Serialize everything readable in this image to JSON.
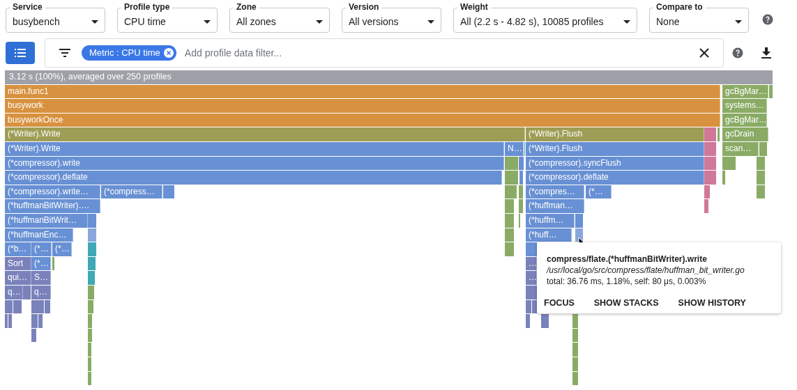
{
  "filters": [
    {
      "label": "Service",
      "value": "busybench"
    },
    {
      "label": "Profile type",
      "value": "CPU time"
    },
    {
      "label": "Zone",
      "value": "All zones"
    },
    {
      "label": "Version",
      "value": "All versions"
    },
    {
      "label": "Weight",
      "value": "All (2.2 s - 4.82 s), 10085 profiles"
    },
    {
      "label": "Compare to",
      "value": "None"
    }
  ],
  "filter_bar": {
    "chip": "Metric : CPU time",
    "placeholder": "Add profile data filter..."
  },
  "flame_graph": {
    "header": "3.12 s (100%), averaged over 250 profiles",
    "frames": [
      {
        "label": "main.func1",
        "color": "#d8923f"
      },
      {
        "label": "gcBgMar…",
        "color": "#8aab65"
      },
      {
        "label": "busywork",
        "color": "#d8923f"
      },
      {
        "label": "systems…",
        "color": "#8aab65"
      },
      {
        "label": "busyworkOnce",
        "color": "#d8923f"
      },
      {
        "label": "gcBgMar…",
        "color": "#8aab65"
      },
      {
        "label": "(*Writer).Write",
        "color": "#9e9d55"
      },
      {
        "label": "(*Writer).Flush",
        "color": "#9e9d55"
      },
      {
        "label": "gcDrain",
        "color": "#8aab65"
      },
      {
        "label": "(*Writer).Write",
        "color": "#6890d4"
      },
      {
        "label": "N…",
        "color": "#6890d4"
      },
      {
        "label": "(*Writer).Flush",
        "color": "#6890d4"
      },
      {
        "label": "scan…",
        "color": "#8aab65"
      },
      {
        "label": "(*compressor).write",
        "color": "#6890d4"
      },
      {
        "label": "(*compressor).syncFlush",
        "color": "#6890d4"
      },
      {
        "label": "(*compressor).deflate",
        "color": "#6890d4"
      },
      {
        "label": "(*compressor).deflate",
        "color": "#6890d4"
      },
      {
        "label": "(*compressor).write…",
        "color": "#6890d4"
      },
      {
        "label": "(*compress…",
        "color": "#6890d4"
      },
      {
        "label": "(*compres…",
        "color": "#6890d4"
      },
      {
        "label": "(*…",
        "color": "#6890d4"
      },
      {
        "label": "(*huffmanBitWriter)….",
        "color": "#6890d4"
      },
      {
        "label": "(*huffman…",
        "color": "#6890d4"
      },
      {
        "label": "(*huffmanBitWrit…",
        "color": "#6890d4"
      },
      {
        "label": "(*huffm…",
        "color": "#6890d4"
      },
      {
        "label": "(*huffmanEnc…",
        "color": "#6890d4"
      },
      {
        "label": "(*huff…",
        "color": "#6890d4"
      },
      {
        "label": "(*b…",
        "color": "#6890d4"
      },
      {
        "label": "(*…",
        "color": "#6890d4"
      },
      {
        "label": "(*…",
        "color": "#6890d4"
      },
      {
        "label": "Sort",
        "color": "#7a82bb"
      },
      {
        "label": "(*…",
        "color": "#6890d4"
      },
      {
        "label": "qui…",
        "color": "#7a82bb"
      },
      {
        "label": "S…",
        "color": "#7a82bb"
      },
      {
        "label": "q…",
        "color": "#7a82bb"
      },
      {
        "label": "q…",
        "color": "#7a82bb"
      },
      {
        "label": "…",
        "color": "#7a82bb"
      },
      {
        "label": "…",
        "color": "#7a82bb"
      }
    ]
  },
  "tooltip": {
    "function": "compress/flate.(*huffmanBitWriter).write",
    "file": "/usr/local/go/src/compress/flate/huffman_bit_writer.go",
    "stats": "total: 36.76 ms, 1.18%, self: 80 μs, 0.003%",
    "actions": [
      "FOCUS",
      "SHOW STACKS",
      "SHOW HISTORY"
    ]
  }
}
